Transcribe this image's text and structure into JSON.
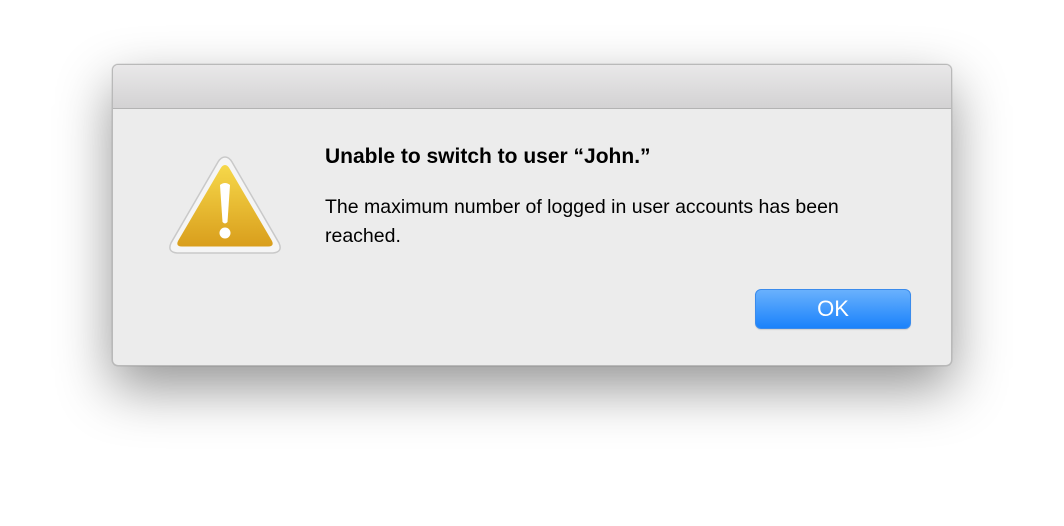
{
  "dialog": {
    "icon": "warning-triangle-icon",
    "title": "Unable to switch to user “John.”",
    "message": "The maximum number of logged in user accounts has been reached.",
    "ok_label": "OK"
  },
  "colors": {
    "dialog_background": "#ececec",
    "accent": "#1a82fb",
    "warning": "#e8b428"
  }
}
